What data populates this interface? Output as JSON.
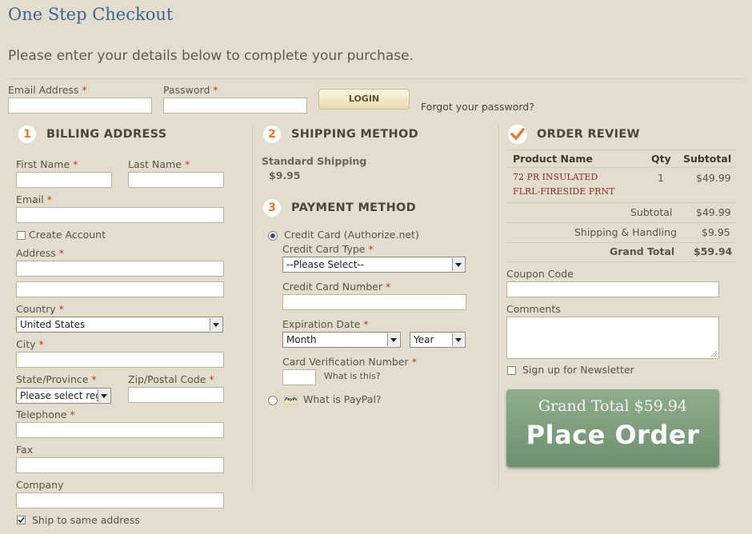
{
  "header": {
    "title": "One Step Checkout",
    "subtitle": "Please enter your details below to complete your purchase."
  },
  "login": {
    "email_label": "Email Address",
    "password_label": "Password",
    "required_mark": "*",
    "login_button": "LOGIN",
    "forgot_link": "Forgot your password?"
  },
  "billing": {
    "number": "1",
    "heading": "BILLING ADDRESS",
    "first_name": "First Name",
    "last_name": "Last Name",
    "email": "Email",
    "create_account": "Create Account",
    "address": "Address",
    "country": "Country",
    "country_value": "United States",
    "city": "City",
    "state": "State/Province",
    "state_value": "Please select reg",
    "zip": "Zip/Postal Code",
    "telephone": "Telephone",
    "fax": "Fax",
    "company": "Company",
    "ship_same": "Ship to same address"
  },
  "shipping": {
    "number": "2",
    "heading": "SHIPPING METHOD",
    "method": "Standard Shipping",
    "price": "$9.95"
  },
  "payment": {
    "number": "3",
    "heading": "PAYMENT METHOD",
    "credit_card": "Credit Card (Authorize.net)",
    "card_type": "Credit Card Type",
    "card_type_value": "--Please Select--",
    "card_number": "Credit Card Number",
    "expiration": "Expiration Date",
    "month": "Month",
    "year": "Year",
    "cvv": "Card Verification Number",
    "what_is_this": "What is this?",
    "paypal_logo": "PayPal",
    "paypal": "What is PayPal?"
  },
  "review": {
    "heading": "ORDER REVIEW",
    "col_product": "Product Name",
    "col_qty": "Qty",
    "col_subtotal": "Subtotal",
    "items": [
      {
        "name_line1": "72 PR INSULATED",
        "name_line2": "FLRL-FIRESIDE PRNT",
        "qty": "1",
        "subtotal": "$49.99"
      }
    ],
    "subtotal_label": "Subtotal",
    "subtotal_value": "$49.99",
    "shipping_label": "Shipping & Handling",
    "shipping_value": "$9.95",
    "grand_label": "Grand Total",
    "grand_value": "$59.94",
    "coupon": "Coupon Code",
    "comments": "Comments",
    "newsletter": "Sign up for Newsletter",
    "place_total": "Grand Total $59.94",
    "place_order": "Place Order"
  },
  "colors": {
    "background": "#e2ddcc",
    "title": "#3d6695",
    "accent_orange": "#e87a2e",
    "button_green": "#7b9b7c"
  }
}
